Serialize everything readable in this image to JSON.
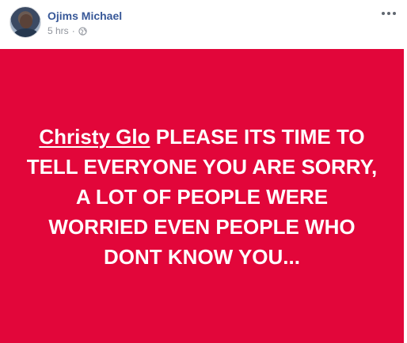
{
  "post": {
    "author": "Ojims Michael",
    "timestamp": "5 hrs",
    "separator": "·",
    "privacy_icon": "globe-icon",
    "menu_icon": "more-options-icon",
    "background_color": "#e2063a",
    "text_color": "#ffffff",
    "mention": "Christy Glo",
    "status_text": " PLEASE ITS TIME TO TELL EVERYONE YOU ARE SORRY, A LOT OF PEOPLE WERE WORRIED EVEN PEOPLE WHO DONT KNOW YOU..."
  }
}
